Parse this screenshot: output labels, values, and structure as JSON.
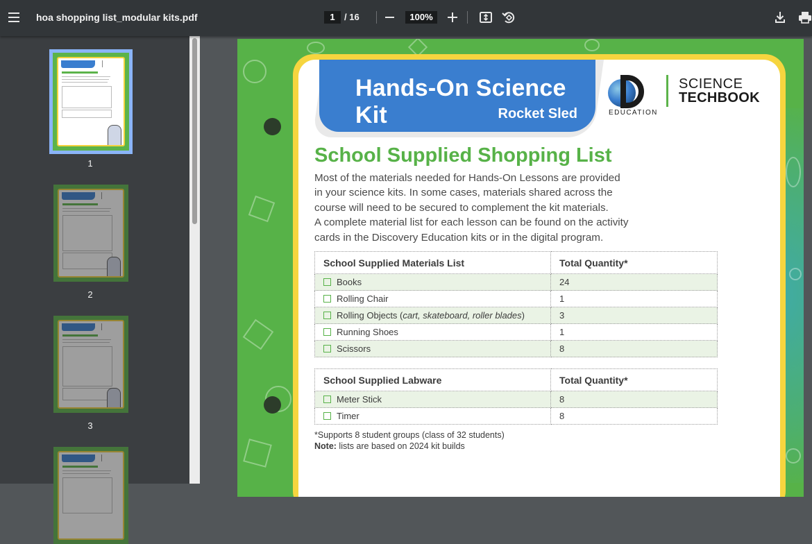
{
  "viewer": {
    "file_name": "hoa shopping list_modular kits.pdf",
    "current_page": "1",
    "total_pages": "/ 16",
    "zoom": "100%",
    "icons": {
      "menu": "hamburger-menu-icon",
      "zoom_out": "minus-icon",
      "zoom_in": "plus-icon",
      "fit": "fit-to-page-icon",
      "rotate": "rotate-icon",
      "download": "download-icon",
      "print": "print-icon"
    }
  },
  "thumbnails": [
    {
      "label": "1",
      "selected": true
    },
    {
      "label": "2",
      "selected": false
    },
    {
      "label": "3",
      "selected": false
    },
    {
      "label": "",
      "selected": false
    }
  ],
  "document": {
    "kit_title": "Hands-On Science Kit",
    "kit_subtitle": "Rocket Sled",
    "logo": {
      "education": "EDUCATION",
      "science": "SCIENCE",
      "techbook": "TECHBOOK"
    },
    "heading": "School Supplied Shopping List",
    "intro_lines": [
      "Most of the materials needed for Hands-On Lessons are provided",
      "in your science kits. In some cases, materials shared across the",
      "course will need to be secured to complement the kit materials.",
      "A complete material list for each lesson can be found on the activity",
      "cards in the Discovery Education kits or in the digital program."
    ],
    "materials_table": {
      "col1": "School Supplied Materials List",
      "col2": "Total Quantity*",
      "rows": [
        {
          "item": "Books",
          "qty": "24"
        },
        {
          "item": "Rolling Chair",
          "qty": "1"
        },
        {
          "item": "Rolling Objects (",
          "item_italic": "cart, skateboard, roller blades",
          "item_end": ")",
          "qty": "3"
        },
        {
          "item": "Running Shoes",
          "qty": "1"
        },
        {
          "item": "Scissors",
          "qty": "8"
        }
      ]
    },
    "labware_table": {
      "col1": "School Supplied Labware",
      "col2": "Total Quantity*",
      "rows": [
        {
          "item": "Meter Stick",
          "qty": "8"
        },
        {
          "item": "Timer",
          "qty": "8"
        }
      ]
    },
    "footnote": "*Supports 8 student groups (class of 32 students)",
    "note_label": "Note:",
    "note_text": " lists are based on 2024 kit builds"
  },
  "colors": {
    "toolbar": "#323639",
    "sidebar": "#3b3e41",
    "page_green": "#57b248",
    "banner_blue": "#3a7ecf",
    "card_border_yellow": "#f6d53f",
    "row_shade": "#eaf3e5"
  }
}
